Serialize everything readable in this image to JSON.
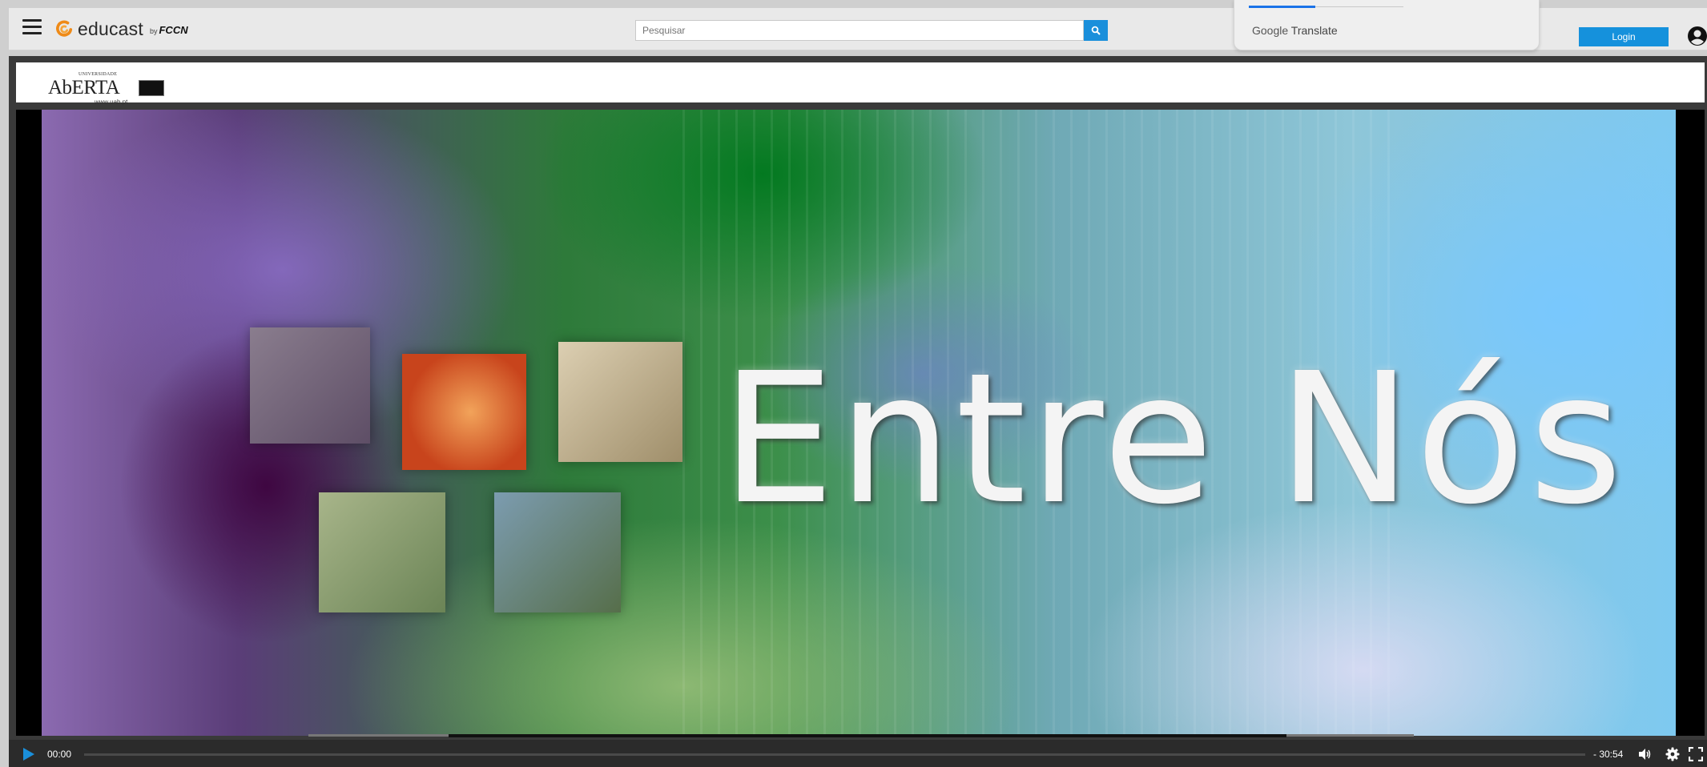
{
  "header": {
    "brand_name": "educast",
    "brand_by": "by",
    "brand_partner": "FCCN",
    "search_placeholder": "Pesquisar",
    "login_label": "Login"
  },
  "translate": {
    "google": "Google",
    "translate": "Translate"
  },
  "channel": {
    "univ_label": "UNIVERSIDADE",
    "name": "AbERTA",
    "url": "www.uab.pt"
  },
  "video": {
    "title_text": "Entre Nós"
  },
  "player": {
    "current_time": "00:00",
    "remaining_time": "- 30:54",
    "progress": 0
  },
  "colors": {
    "accent": "#1a8fdb",
    "login": "#1591dc",
    "control_bar": "#2b2b2b"
  },
  "icons": [
    "menu-icon",
    "educast-logo-icon",
    "search-icon",
    "user-icon",
    "play-icon",
    "volume-icon",
    "settings-icon",
    "fullscreen-icon"
  ]
}
